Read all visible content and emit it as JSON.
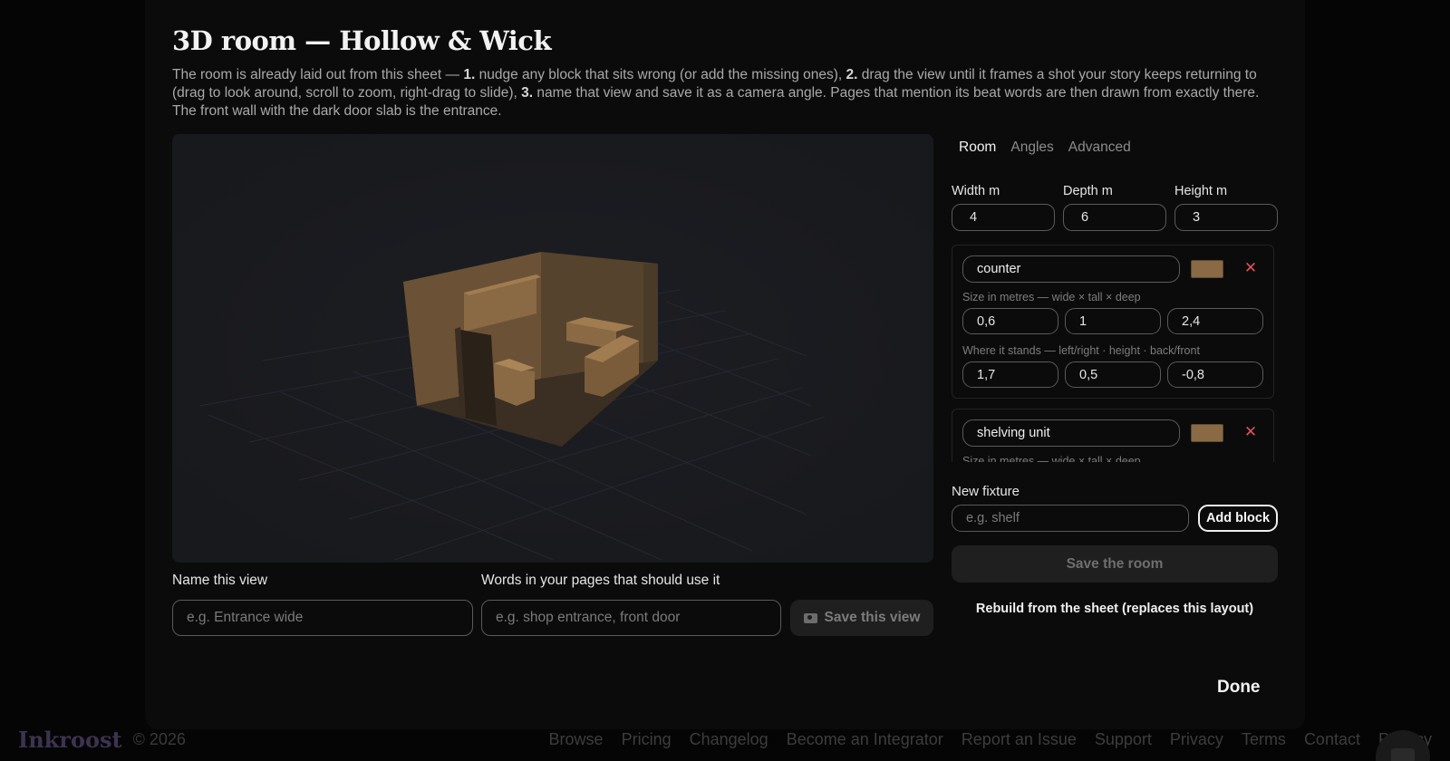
{
  "modal": {
    "title": "3D room — Hollow & Wick",
    "intro": {
      "p1": "The room is already laid out from this sheet — ",
      "s1": "1.",
      "p2": " nudge any block that sits wrong (or add the missing ones), ",
      "s2": "2.",
      "p3": " drag the view until it frames a shot your story keeps returning to (drag to look around, scroll to zoom, right-drag to slide), ",
      "s3": "3.",
      "p4": " name that view and save it as a camera angle. Pages that mention its beat words are then drawn from exactly there. The front wall with the dark door slab is the entrance."
    },
    "view": {
      "name_label": "Name this view",
      "name_placeholder": "e.g. Entrance wide",
      "words_label": "Words in your pages that should use it",
      "words_placeholder": "e.g. shop entrance, front door",
      "save_label": "Save this view",
      "save_icon": "camera-icon"
    },
    "tabs": [
      {
        "label": "Room",
        "active": true
      },
      {
        "label": "Angles",
        "active": false
      },
      {
        "label": "Advanced",
        "active": false
      }
    ],
    "room": {
      "width_label": "Width m",
      "width": "4",
      "depth_label": "Depth m",
      "depth": "6",
      "height_label": "Height m",
      "height": "3"
    },
    "fixtures": [
      {
        "name": "counter",
        "color": "#8a6a44",
        "size_hint": "Size in metres — wide × tall × deep",
        "size": [
          "0,6",
          "1",
          "2,4"
        ],
        "pos_hint": "Where it stands — left/right · height · back/front",
        "pos": [
          "1,7",
          "0,5",
          "-0,8"
        ]
      },
      {
        "name": "shelving unit",
        "color": "#8a6a44",
        "size_hint": "Size in metres — wide × tall × deep"
      }
    ],
    "remove_symbol": "✕",
    "new_fixture": {
      "label": "New fixture",
      "placeholder": "e.g. shelf",
      "add_label": "Add block"
    },
    "save_room_label": "Save the room",
    "rebuild_label": "Rebuild from the sheet (replaces this layout)",
    "done_label": "Done",
    "colors": {
      "wood": "#8a6a44",
      "door": "#2a2118",
      "remove": "#e0525a",
      "viewport_bg": "#1a1b20"
    }
  },
  "footer": {
    "brand": "Inkroost",
    "copyright": "© 2026",
    "links": [
      "Browse",
      "Pricing",
      "Changelog",
      "Become an Integrator",
      "Report an Issue",
      "Support",
      "Privacy",
      "Terms",
      "Contact",
      "Privacy"
    ]
  }
}
